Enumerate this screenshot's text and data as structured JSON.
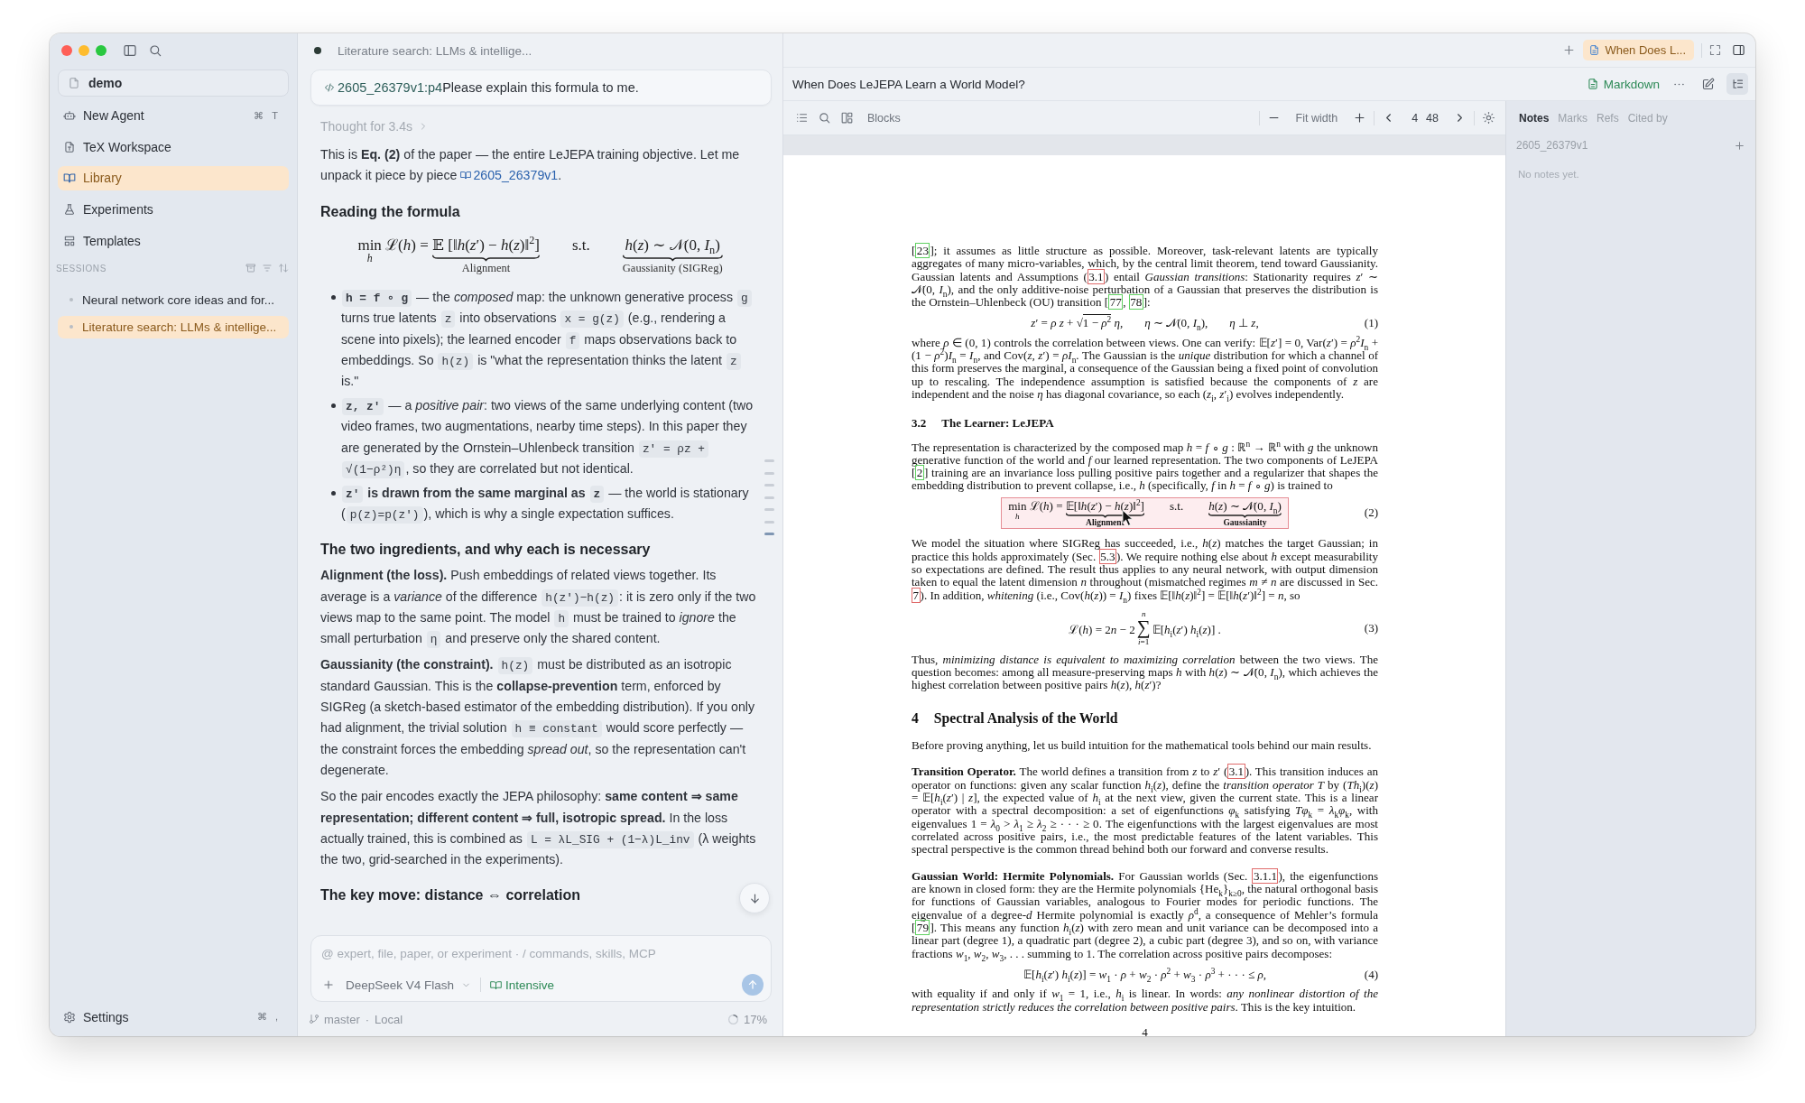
{
  "sidebar": {
    "workspace": "demo",
    "nav": [
      {
        "label": "New Agent",
        "shortcut": [
          "⌘",
          "T"
        ],
        "selected": false
      },
      {
        "label": "TeX Workspace",
        "selected": false
      },
      {
        "label": "Library",
        "selected": true
      },
      {
        "label": "Experiments",
        "selected": false
      },
      {
        "label": "Templates",
        "selected": false
      }
    ],
    "sessions_heading": "SESSIONS",
    "sessions": [
      {
        "title": "Neural network core ideas and for...",
        "selected": false
      },
      {
        "title": "Literature search: LLMs & intellige...",
        "selected": true
      }
    ],
    "settings": {
      "label": "Settings",
      "shortcut": [
        "⌘",
        ","
      ]
    }
  },
  "chat": {
    "title": "Literature search: LLMs & intellige...",
    "user_message": {
      "reference": "2605_26379v1:p4",
      "text": "Please explain this formula to me."
    },
    "thought": {
      "label": "Thought for 3.4s",
      "expanded": false
    },
    "blocks": [
      {
        "kind": "paragraph",
        "parts": [
          {
            "kind": "text",
            "text": "This is **Eq. (2)** of the paper — the entire LeJEPA training objective. Let me unpack it piece by piece "
          },
          {
            "kind": "link",
            "text": "2605_26379v1"
          },
          {
            "kind": "text",
            "text": "."
          }
        ]
      },
      {
        "kind": "heading",
        "text": "Reading the formula"
      },
      {
        "kind": "formula",
        "terms": [
          [
            {
              "kind": "limits",
              "text": "min",
              "below": "*h*"
            },
            {
              "kind": "text",
              "text": " ℒ(*h*) = "
            },
            {
              "kind": "brace",
              "text": "𝔼 [‖*h*(*z*′) − *h*(*z*)‖$^{2}$]",
              "label": "Alignment"
            }
          ],
          [
            {
              "kind": "text",
              "text": "s.t."
            }
          ],
          [
            {
              "kind": "brace",
              "text": "*h*(*z*) ∼ 𝒩(0, *I*$_{n}$)",
              "label": "Gaussianity (SIGReg)"
            }
          ]
        ]
      },
      {
        "kind": "bullets",
        "items": [
          [
            {
              "kind": "code",
              "text": "**h = f ∘ g**"
            },
            {
              "kind": "text",
              "text": " — the *composed* map: the unknown generative process "
            },
            {
              "kind": "code",
              "text": "g"
            },
            {
              "kind": "text",
              "text": " turns true latents "
            },
            {
              "kind": "code",
              "text": "z"
            },
            {
              "kind": "text",
              "text": " into observations "
            },
            {
              "kind": "code",
              "text": "x = g(z)"
            },
            {
              "kind": "text",
              "text": " (e.g., rendering a scene into pixels); the learned encoder "
            },
            {
              "kind": "code",
              "text": "f"
            },
            {
              "kind": "text",
              "text": " maps observations back to embeddings. So "
            },
            {
              "kind": "code",
              "text": "h(z)"
            },
            {
              "kind": "text",
              "text": " is \"what the representation thinks the latent "
            },
            {
              "kind": "code",
              "text": "z"
            },
            {
              "kind": "text",
              "text": " is.\""
            }
          ],
          [
            {
              "kind": "code",
              "text": "**z, z′**"
            },
            {
              "kind": "text",
              "text": " — a *positive pair*: two views of the same underlying content (two video frames, two augmentations, nearby time steps). In this paper they are generated by the Ornstein–Uhlenbeck transition "
            },
            {
              "kind": "code",
              "text": "z′ = ρz + √(1−ρ²)η"
            },
            {
              "kind": "text",
              "text": ", so they are correlated but not identical."
            }
          ],
          [
            {
              "kind": "code",
              "text": "**z′**"
            },
            {
              "kind": "text",
              "text": " **is drawn from the same marginal as** "
            },
            {
              "kind": "code",
              "text": "**z**"
            },
            {
              "kind": "text",
              "text": " — the world is stationary ("
            },
            {
              "kind": "code",
              "text": "p(z)=p(z′)"
            },
            {
              "kind": "text",
              "text": "), which is why a single expectation suffices."
            }
          ]
        ]
      },
      {
        "kind": "heading",
        "text": "The two ingredients, and why each is necessary"
      },
      {
        "kind": "paragraph",
        "parts": [
          {
            "kind": "text",
            "text": "**Alignment (the loss).** Push embeddings of related views together. Its average is a *variance* of the difference "
          },
          {
            "kind": "code",
            "text": "h(z′)−h(z)"
          },
          {
            "kind": "text",
            "text": ": it is zero only if the two views map to the same point. The model "
          },
          {
            "kind": "code",
            "text": "h"
          },
          {
            "kind": "text",
            "text": " must be trained to *ignore* the small perturbation "
          },
          {
            "kind": "code",
            "text": "η"
          },
          {
            "kind": "text",
            "text": " and preserve only the shared content."
          }
        ]
      },
      {
        "kind": "paragraph",
        "parts": [
          {
            "kind": "text",
            "text": "**Gaussianity (the constraint).** "
          },
          {
            "kind": "code",
            "text": "h(z)"
          },
          {
            "kind": "text",
            "text": " must be distributed as an isotropic standard Gaussian. This is the **collapse-prevention** term, enforced by SIGReg (a sketch-based estimator of the embedding distribution). If you only had alignment, the trivial solution "
          },
          {
            "kind": "code",
            "text": "h ≡ constant"
          },
          {
            "kind": "text",
            "text": " would score perfectly — the constraint forces the embedding *spread out*, so the representation can't degenerate."
          }
        ]
      },
      {
        "kind": "paragraph",
        "parts": [
          {
            "kind": "text",
            "text": "So the pair encodes exactly the JEPA philosophy: **same content ⇒ same representation; different content ⇒ full, isotropic spread.** In the loss actually trained, this is combined as "
          },
          {
            "kind": "code",
            "text": "L = λL_SIG + (1−λ)L_inv"
          },
          {
            "kind": "text",
            "text": " (λ weights the two, grid-searched in the experiments)."
          }
        ]
      },
      {
        "kind": "heading",
        "text": "The key move: distance ⇔ correlation"
      }
    ],
    "outline_markers": [
      {
        "selected": false
      },
      {
        "selected": false
      },
      {
        "selected": false
      },
      {
        "selected": false
      },
      {
        "selected": false
      },
      {
        "selected": false
      },
      {
        "selected": true
      }
    ]
  },
  "composer": {
    "placeholder": "@ expert, file, paper, or experiment · / commands, skills, MCP",
    "model": "DeepSeek V4 Flash",
    "mode": {
      "label": "Intensive",
      "on": true
    }
  },
  "status_bar": {
    "branch": "master",
    "separator": "·",
    "location": "Local",
    "context": {
      "label": "17%",
      "level": 0.17
    }
  },
  "viewer": {
    "tabs": [
      {
        "label": "When Does L...",
        "selected": true
      }
    ],
    "title": "When Does LeJEPA Learn a World Model?",
    "format_button": "Markdown",
    "toolbar": {
      "view": "Blocks",
      "zoom": "Fit width",
      "page": "4",
      "page_count": "48"
    },
    "page": {
      "blocks": [
        {
          "kind": "para",
          "parts": [
            {
              "kind": "text",
              "text": "["
            },
            {
              "kind": "cite",
              "text": "23"
            },
            {
              "kind": "text",
              "text": "]; it assumes as little structure as possible. Moreover, task-relevant latents are typically aggregates of many micro-variables, which, by the central limit theorem, tend toward Gaussianity. Gaussian latents and Assumptions ("
            },
            {
              "kind": "ref",
              "text": "3.1"
            },
            {
              "kind": "text",
              "text": ") entail *Gaussian transitions*: Stationarity requires *z*′ ∼ 𝒩(0, *I*$_{n}$), and the only additive-noise perturbation of a Gaussian that preserves the distribution is the Ornstein–Uhlenbeck (OU) transition ["
            },
            {
              "kind": "cite",
              "text": "77"
            },
            {
              "kind": "text",
              "text": ", "
            },
            {
              "kind": "cite",
              "text": "78"
            },
            {
              "kind": "text",
              "text": "]:"
            }
          ]
        },
        {
          "kind": "equation",
          "number": "(1)",
          "terms": [
            [
              {
                "kind": "text",
                "text": "*z*′ = *ρ z* + √"
              },
              {
                "kind": "radicand",
                "text": "1 − *ρ*$^{2}$"
              },
              {
                "kind": "text",
                "text": " *η*,"
              }
            ],
            [
              {
                "kind": "text",
                "text": "*η* ∼ 𝒩(0, *I*$_{n}$),"
              }
            ],
            [
              {
                "kind": "text",
                "text": "*η* ⊥ *z*,"
              }
            ]
          ]
        },
        {
          "kind": "para",
          "parts": [
            {
              "kind": "text",
              "text": "where *ρ* ∈ (0, 1) controls the correlation between views. One can verify: 𝔼[*z*′] = 0, Var(*z*′) = *ρ*$^{2}$*I*$_{n}$ + (1 − *ρ*$^{2}$)*I*$_{n}$ = *I*$_{n}$, and Cov(*z*, *z*′) = *ρI*$_{n}$. The Gaussian is the *unique* distribution for which a channel of this form preserves the marginal, a consequence of the Gaussian being a fixed point of convolution up to rescaling. The independence assumption is satisfied because the components of *z* are independent and the noise *η* has diagonal covariance, so each (*z*$_{i}$, *z*′$_{i}$) evolves independently."
            }
          ]
        },
        {
          "kind": "subsection",
          "number": "3.2",
          "title": "The Learner: LeJEPA"
        },
        {
          "kind": "para",
          "parts": [
            {
              "kind": "text",
              "text": "The representation is characterized by the composed map *h* = *f* ∘ *g* : ℝ$^{n}$ → ℝ$^{n}$ with *g* the unknown generative function of the world and *f* our learned representation. The two components of LeJEPA ["
            },
            {
              "kind": "cite",
              "text": "2"
            },
            {
              "kind": "text",
              "text": "] training are an invariance loss pulling positive pairs together and a regularizer that shapes the embedding distribution to prevent collapse, i.e., *h* (specifically, *f* in *h* = *f* ∘ *g*) is trained to"
            }
          ]
        },
        {
          "kind": "highlight",
          "number": "(2)",
          "terms": [
            [
              {
                "kind": "limits",
                "text": "min",
                "below": "*h*"
              },
              {
                "kind": "text",
                "text": " ℒ(*h*) = "
              },
              {
                "kind": "brace",
                "text": "𝔼[‖*h*(*z*′) − *h*(*z*)‖$^{2}$]",
                "label": "Alignment"
              }
            ],
            [
              {
                "kind": "text",
                "text": "s.t."
              }
            ],
            [
              {
                "kind": "brace",
                "text": "*h*(*z*) ∼ 𝒩(0, *I*$_{n}$)",
                "label": "Gaussianity"
              }
            ]
          ]
        },
        {
          "kind": "para",
          "parts": [
            {
              "kind": "text",
              "text": "We model the situation where SIGReg has succeeded, i.e., *h*(*z*) matches the target Gaussian; in practice this holds approximately (Sec. "
            },
            {
              "kind": "ref",
              "text": "5.3"
            },
            {
              "kind": "text",
              "text": "). We require nothing else about *h* except measurability so expectations are defined. The result thus applies to any neural network, with output dimension taken to equal the latent dimension *n* throughout (mismatched regimes *m* ≠ *n* are discussed in Sec. "
            },
            {
              "kind": "ref",
              "text": "7"
            },
            {
              "kind": "text",
              "text": "). In addition, *whitening* (i.e., Cov(*h*(*z*)) = *I*$_{n}$) fixes 𝔼[‖*h*(*z*)‖$^{2}$] = 𝔼[‖*h*(*z*′)‖$^{2}$] = *n*, so"
            }
          ]
        },
        {
          "kind": "equation",
          "number": "(3)",
          "terms": [
            [
              {
                "kind": "text",
                "text": "ℒ(*h*) = 2"
              },
              {
                "kind": "text",
                "text": "*n* − 2"
              },
              {
                "kind": "limits",
                "text": "∑",
                "above": "*n*",
                "below": "*i*=1"
              },
              {
                "kind": "text",
                "text": "𝔼[*h*$_{i}$(*z*′) *h*$_{i}$(*z*)] ."
              }
            ]
          ]
        },
        {
          "kind": "para",
          "parts": [
            {
              "kind": "text",
              "text": "Thus, *minimizing distance is equivalent to maximizing correlation* between the two views. The question becomes: among all measure-preserving maps *h* with *h*(*z*) ∼ 𝒩(0, *I*$_{n}$), which achieves the highest correlation between positive pairs *h*(*z*), *h*(*z*′)?"
            }
          ]
        },
        {
          "kind": "section",
          "number": "4",
          "title": "Spectral Analysis of the World"
        },
        {
          "kind": "para",
          "parts": [
            {
              "kind": "text",
              "text": "Before proving anything, let us build intuition for the mathematical tools behind our main results."
            }
          ]
        },
        {
          "kind": "para",
          "parts": [
            {
              "kind": "text",
              "text": "**Transition Operator.**  The world defines a transition from *z* to *z*′ ("
            },
            {
              "kind": "ref",
              "text": "3.1"
            },
            {
              "kind": "text",
              "text": "). This transition induces an operator on functions: given any scalar function *h*$_{i}$(*z*), define the *transition operator T* by (*Th*$_{i}$)(*z*) = 𝔼[*h*$_{i}$(*z*′) | *z*], the expected value of *h*$_{i}$ at the next view, given the current state. This is a linear operator with a spectral decomposition: a set of eigenfunctions *φ*$_{k}$ satisfying *Tφ*$_{k}$ = *λ*$_{k}$*φ*$_{k}$, with eigenvalues 1 = *λ*$_{0}$ > *λ*$_{1}$ ≥ *λ*$_{2}$ ≥ · · · ≥ 0. The eigenfunctions with the largest eigenvalues are most correlated across positive pairs, i.e., the most predictable features of the latent variables. This spectral perspective is the common thread behind both our forward and converse results."
            }
          ]
        },
        {
          "kind": "para",
          "parts": [
            {
              "kind": "text",
              "text": "**Gaussian World: Hermite Polynomials.**  For Gaussian worlds (Sec. "
            },
            {
              "kind": "ref",
              "text": "3.1.1"
            },
            {
              "kind": "text",
              "text": "), the eigenfunctions are known in closed form: they are the Hermite polynomials {He$_{k}$}$_{k≥0}$, the natural orthogonal basis for functions of Gaussian variables, analogous to Fourier modes for periodic functions. The eigenvalue of a degree-*d* Hermite polynomial is exactly *ρ*$^{d}$, a consequence of Mehler’s formula ["
            },
            {
              "kind": "cite",
              "text": "79"
            },
            {
              "kind": "text",
              "text": "]. This means any function *h*$_{i}$(*z*) with zero mean and unit variance can be decomposed into a linear part (degree 1), a quadratic part (degree 2), a cubic part (degree 3), and so on, with variance fractions *w*$_{1}$, *w*$_{2}$, *w*$_{3}$, . . . summing to 1. The correlation across positive pairs decomposes:"
            }
          ]
        },
        {
          "kind": "equation",
          "number": "(4)",
          "terms": [
            [
              {
                "kind": "text",
                "text": "𝔼[*h*$_{i}$(*z*′) *h*$_{i}$(*z*)] = *w*$_{1}$ · *ρ* + *w*$_{2}$ · *ρ*$^{2}$ + *w*$_{3}$ · *ρ*$^{3}$ + · · · ≤ *ρ*,"
              }
            ]
          ]
        },
        {
          "kind": "para",
          "parts": [
            {
              "kind": "text",
              "text": "with equality if and only if *w*$_{1}$ = 1, i.e., *h*$_{i}$ is linear. In words: *any nonlinear distortion of the representation strictly reduces the correlation between positive pairs*. This is the key intuition."
            }
          ]
        }
      ],
      "page_number": "4"
    }
  },
  "notes": {
    "tabs": [
      {
        "label": "Notes",
        "selected": true
      },
      {
        "label": "Marks",
        "selected": false
      },
      {
        "label": "Refs",
        "selected": false
      },
      {
        "label": "Cited by",
        "selected": false
      }
    ],
    "paper": "2605_26379v1",
    "empty_text": "No notes yet."
  }
}
